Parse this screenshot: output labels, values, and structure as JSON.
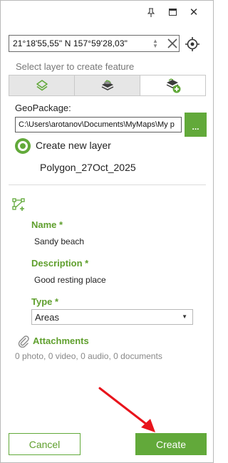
{
  "window": {
    "pin_icon": "pin-icon",
    "maximize_icon": "maximize-icon",
    "close_icon": "close-icon",
    "close_glyph": "✕"
  },
  "coordinates": {
    "value": "21°18'55,55\" N 157°59'28,03\"",
    "clear_icon": "clear-icon",
    "locate_icon": "locate-icon"
  },
  "layer_hint": "Select layer to create feature",
  "layer_tabs": [
    {
      "icon": "layers-icon",
      "active": false
    },
    {
      "icon": "layer-stack-icon",
      "active": false
    },
    {
      "icon": "add-layer-icon",
      "active": true
    }
  ],
  "geopackage": {
    "label": "GeoPackage:",
    "path": "C:\\Users\\arotanov\\Documents\\MyMaps\\My p",
    "browse_label": "..."
  },
  "new_layer": {
    "label": "Create new layer",
    "selected": true,
    "name": "Polygon_27Oct_2025"
  },
  "form": {
    "geometry_icon": "polygon-edit-icon",
    "name_label": "Name *",
    "name_value": "Sandy beach",
    "description_label": "Description *",
    "description_value": "Good resting place",
    "type_label": "Type *",
    "type_value": "Areas",
    "type_caret": "▼"
  },
  "attachments": {
    "label": "Attachments",
    "summary": "0 photo, 0 video, 0 audio, 0 documents"
  },
  "buttons": {
    "cancel": "Cancel",
    "create": "Create"
  },
  "colors": {
    "accent": "#62a93a",
    "annotation_arrow": "#e8141c"
  }
}
